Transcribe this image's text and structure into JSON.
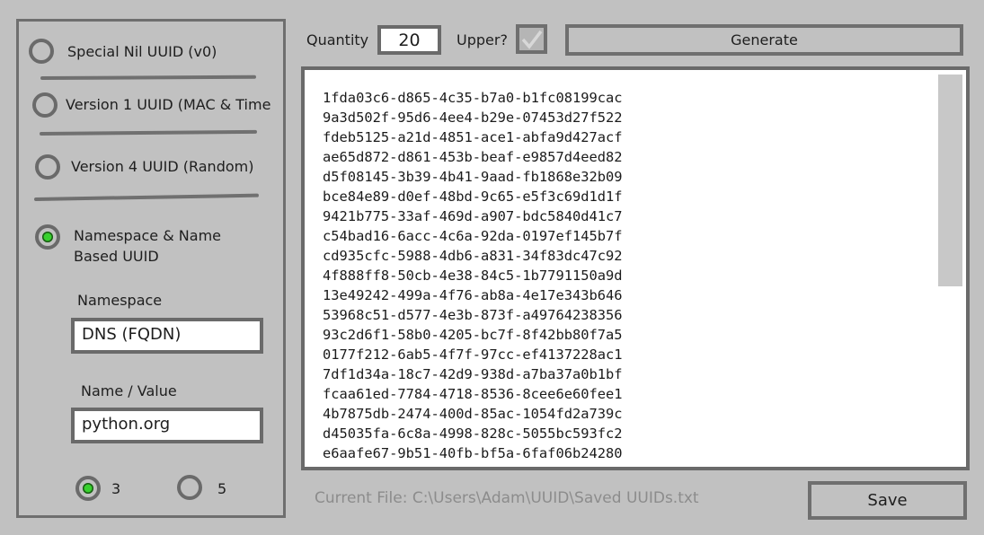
{
  "uuid_options": [
    {
      "label": "Special Nil UUID (v0)",
      "selected": false
    },
    {
      "label": "Version 1 UUID (MAC & Time",
      "selected": false
    },
    {
      "label": "Version 4 UUID (Random)",
      "selected": false
    },
    {
      "label_line1": "Namespace & Name",
      "label_line2": "Based UUID",
      "selected": true
    }
  ],
  "namespace": {
    "label": "Namespace",
    "value": "DNS (FQDN)"
  },
  "name_value": {
    "label": "Name / Value",
    "value": "python.org"
  },
  "version_radios": [
    {
      "label": "3",
      "selected": true
    },
    {
      "label": "5",
      "selected": false
    }
  ],
  "toolbar": {
    "quantity_label": "Quantity",
    "quantity_value": "20",
    "upper_label": "Upper?",
    "upper_checked": true,
    "generate_label": "Generate"
  },
  "uuids": [
    "1fda03c6-d865-4c35-b7a0-b1fc08199cac",
    "9a3d502f-95d6-4ee4-b29e-07453d27f522",
    "fdeb5125-a21d-4851-ace1-abfa9d427acf",
    "ae65d872-d861-453b-beaf-e9857d4eed82",
    "d5f08145-3b39-4b41-9aad-fb1868e32b09",
    "bce84e89-d0ef-48bd-9c65-e5f3c69d1d1f",
    "9421b775-33af-469d-a907-bdc5840d41c7",
    "c54bad16-6acc-4c6a-92da-0197ef145b7f",
    "cd935cfc-5988-4db6-a831-34f83dc47c92",
    "4f888ff8-50cb-4e38-84c5-1b7791150a9d",
    "13e49242-499a-4f76-ab8a-4e17e343b646",
    "53968c51-d577-4e3b-873f-a49764238356",
    "93c2d6f1-58b0-4205-bc7f-8f42bb80f7a5",
    "0177f212-6ab5-4f7f-97cc-ef4137228ac1",
    "7df1d34a-18c7-42d9-938d-a7ba37a0b1bf",
    "fcaa61ed-7784-4718-8536-8cee6e60fee1",
    "4b7875db-2474-400d-85ac-1054fd2a739c",
    "d45035fa-6c8a-4998-828c-5055bc593fc2",
    "e6aafe67-9b51-40fb-bf5a-6faf06b24280"
  ],
  "footer": {
    "current_file": "Current File: C:\\Users\\Adam\\UUID\\Saved UUIDs.txt",
    "save_label": "Save"
  },
  "colors": {
    "background": "#c1c1c1",
    "border": "#6f6f6f",
    "radio_selected": "#38d12e",
    "output_background": "#ffffff"
  },
  "icons": {
    "checkbox_mark": "checkmark-icon"
  }
}
